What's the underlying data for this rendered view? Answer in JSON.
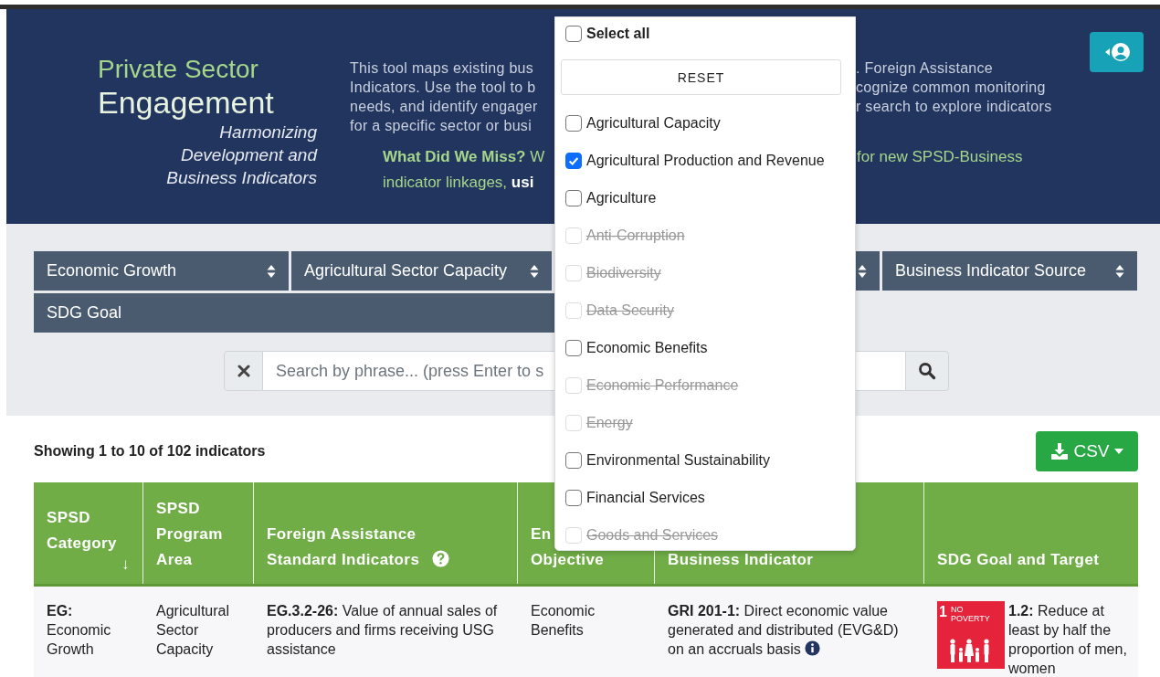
{
  "header": {
    "title_line1": "Private Sector",
    "title_line2": "Engagement",
    "subtitle": [
      "Harmonizing",
      "Development and",
      "Business Indicators"
    ],
    "description": [
      {
        "left": "This tool maps existing bus",
        "right": ". Foreign Assistance"
      },
      {
        "left": "Indicators. Use the tool to b",
        "right": "cognize common monitoring"
      },
      {
        "left": "needs, and identify engager",
        "right": "r search to explore indicators"
      },
      {
        "left": "for a specific sector or busi"
      }
    ],
    "cta": [
      {
        "left": "**What Did We Miss?** W",
        "right": "for new SPSD-Business"
      },
      {
        "left": "indicator linkages, **usi**"
      }
    ]
  },
  "filters": [
    {
      "kind": "select",
      "label": "Economic Growth"
    },
    {
      "kind": "select",
      "label": "Agricultural Sector Capacity"
    },
    {
      "kind": "select"
    },
    {
      "kind": "select",
      "label": "Business Indicator Source"
    },
    {
      "kind": "wide",
      "label": "SDG Goal"
    }
  ],
  "search": {
    "placeholder": "Search by phrase... (press Enter to s"
  },
  "results": {
    "summary": "Showing 1 to 10 of 102 indicators",
    "export_label": "CSV"
  },
  "table": {
    "columns": [
      {
        "lines": [
          "SPSD",
          "Category"
        ],
        "sort": "↓"
      },
      {
        "lines": [
          "SPSD",
          "Program",
          "Area"
        ]
      },
      {
        "lines": [
          "Foreign Assistance",
          "Standard Indicators"
        ],
        "help": true
      },
      {
        "lines": [
          "En",
          "Objective"
        ]
      },
      {
        "lines": [
          "Business Indicator"
        ]
      },
      {
        "lines": [
          "SDG Goal and Target"
        ]
      }
    ],
    "rows": [
      {
        "cells": [
          {
            "kind": "text",
            "text": "**EG:** Economic Growth"
          },
          {
            "kind": "text",
            "text": "Agricultural Sector Capacity"
          },
          {
            "kind": "text",
            "text": "**EG.3.2-26:** Value of annual sales of producers and firms receiving USG assistance"
          },
          {
            "kind": "text",
            "text": "Economic Benefits"
          },
          {
            "kind": "info",
            "text": "**GRI 201-1:** Direct economic value generated and distributed (EVG&D) on an accruals basis"
          },
          {
            "kind": "sdg",
            "badge_number": "1",
            "badge_label": "NO POVERTY",
            "color": "#e5243b",
            "text": "**1.2:** Reduce at least by half the proportion of men, women"
          }
        ]
      }
    ]
  },
  "dropdown": {
    "select_all": "Select all",
    "select_all_checked": false,
    "reset": "RESET",
    "options": [
      {
        "label": "Agricultural Capacity",
        "checked": false,
        "disabled": false
      },
      {
        "label": "Agricultural Production and Revenue",
        "checked": true,
        "disabled": false
      },
      {
        "label": "Agriculture",
        "checked": false,
        "disabled": false
      },
      {
        "label": "Anti-Corruption",
        "checked": false,
        "disabled": true
      },
      {
        "label": "Biodiversity",
        "checked": false,
        "disabled": true
      },
      {
        "label": "Data Security",
        "checked": false,
        "disabled": true
      },
      {
        "label": "Economic Benefits",
        "checked": false,
        "disabled": false
      },
      {
        "label": "Economic Performance",
        "checked": false,
        "disabled": true
      },
      {
        "label": "Energy",
        "checked": false,
        "disabled": true
      },
      {
        "label": "Environmental Sustainability",
        "checked": false,
        "disabled": false
      },
      {
        "label": "Financial Services",
        "checked": false,
        "disabled": false
      },
      {
        "label": "Goods and Services",
        "checked": false,
        "disabled": true
      }
    ]
  }
}
